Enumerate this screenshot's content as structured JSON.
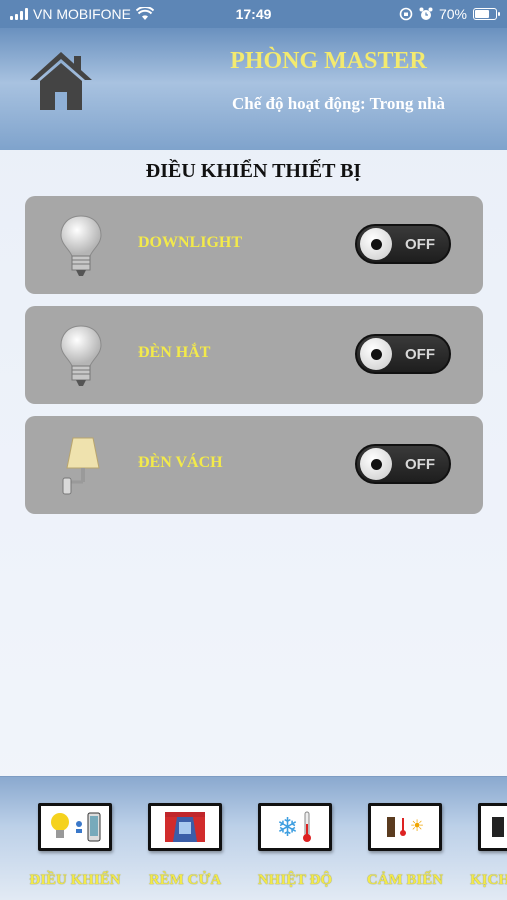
{
  "status_bar": {
    "carrier": "VN MOBIFONE",
    "time": "17:49",
    "battery": "70%",
    "battery_level": 0.7
  },
  "header": {
    "room_title": "PHÒNG MASTER",
    "mode": "Chế độ hoạt động: Trong nhà",
    "home_icon": "home-icon"
  },
  "section": {
    "title": "ĐIỀU KHIỂN THIẾT BỊ"
  },
  "devices": [
    {
      "name": "DOWNLIGHT",
      "icon": "light-bulb-icon",
      "state": "OFF"
    },
    {
      "name": "ĐÈN HẮT",
      "icon": "light-bulb-icon",
      "state": "OFF"
    },
    {
      "name": "ĐÈN VÁCH",
      "icon": "wall-lamp-icon",
      "state": "OFF"
    }
  ],
  "bottom_nav": [
    {
      "label": "ĐIỀU KHIỂN",
      "icon": "device-control-icon"
    },
    {
      "label": "RÈM CỬA",
      "icon": "curtain-icon"
    },
    {
      "label": "NHIỆT ĐỘ",
      "icon": "temperature-icon"
    },
    {
      "label": "CẢM BIẾN",
      "icon": "sensor-icon"
    },
    {
      "label": "KỊCH",
      "icon": "scene-icon"
    }
  ],
  "colors": {
    "title_yellow": "#f3ea6f",
    "device_label_yellow": "#f3ea4a",
    "row_gray": "#a7a7a7",
    "header_blue": "#6a91bf"
  }
}
